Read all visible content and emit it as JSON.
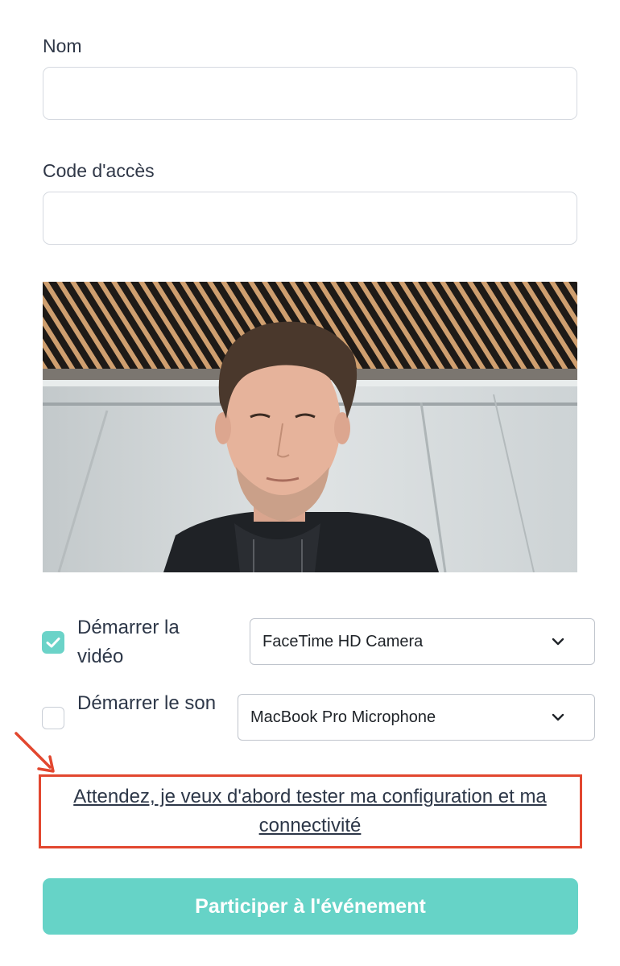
{
  "form": {
    "name_label": "Nom",
    "name_value": "",
    "code_label": "Code d'accès",
    "code_value": ""
  },
  "video_preview": {
    "description_icon": "camera-preview"
  },
  "options": {
    "video": {
      "label": "Démarrer la vidéo",
      "checked": true,
      "device": "FaceTime HD Camera"
    },
    "audio": {
      "label": "Démarrer le son",
      "checked": false,
      "device": "MacBook Pro Microphone"
    }
  },
  "test_link": "Attendez, je veux d'abord tester ma configuration et ma connectivité",
  "join_button": "Participer à l'événement",
  "colors": {
    "accent": "#66d3c7",
    "annotation": "#e2472f"
  }
}
